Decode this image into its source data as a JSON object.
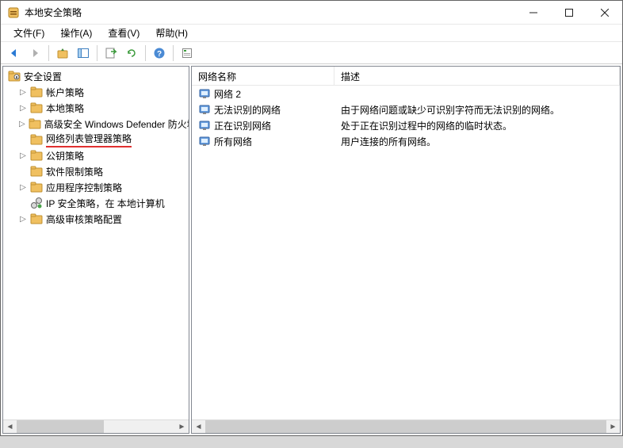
{
  "window": {
    "title": "本地安全策略"
  },
  "menus": {
    "file": "文件(F)",
    "action": "操作(A)",
    "view": "查看(V)",
    "help": "帮助(H)"
  },
  "tree": {
    "root": "安全设置",
    "items": [
      {
        "label": "帐户策略",
        "expandable": true
      },
      {
        "label": "本地策略",
        "expandable": true
      },
      {
        "label": "高级安全 Windows Defender 防火墙",
        "expandable": true
      },
      {
        "label": "网络列表管理器策略",
        "expandable": false,
        "selected": true
      },
      {
        "label": "公钥策略",
        "expandable": true
      },
      {
        "label": "软件限制策略",
        "expandable": false
      },
      {
        "label": "应用程序控制策略",
        "expandable": true
      },
      {
        "label": "IP 安全策略，在 本地计算机",
        "expandable": false,
        "ip": true
      },
      {
        "label": "高级审核策略配置",
        "expandable": true
      }
    ]
  },
  "list": {
    "columns": {
      "name": "网络名称",
      "desc": "描述"
    },
    "rows": [
      {
        "name": "网络 2",
        "desc": ""
      },
      {
        "name": "无法识别的网络",
        "desc": "由于网络问题或缺少可识别字符而无法识别的网络。"
      },
      {
        "name": "正在识别网络",
        "desc": "处于正在识别过程中的网络的临时状态。"
      },
      {
        "name": "所有网络",
        "desc": "用户连接的所有网络。"
      }
    ]
  }
}
